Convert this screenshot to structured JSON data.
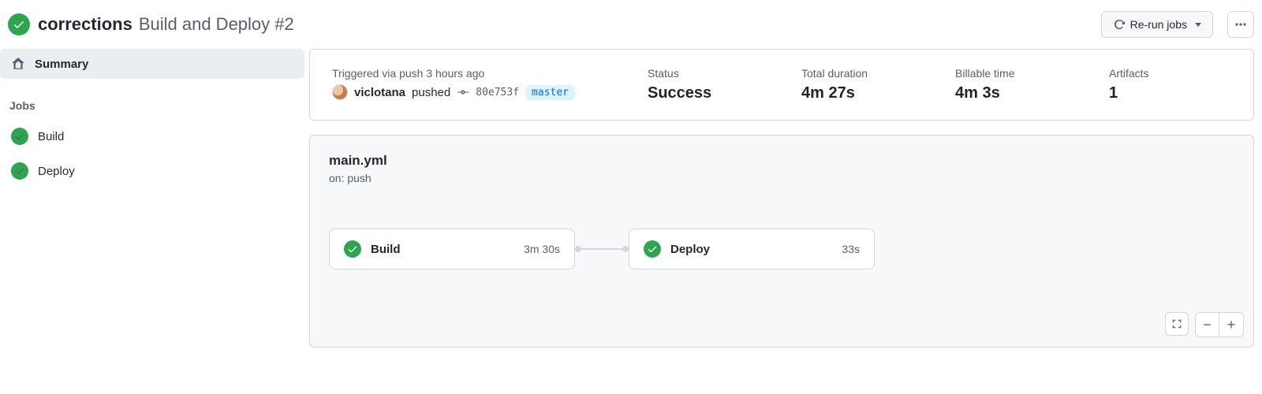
{
  "header": {
    "commit_message": "corrections",
    "workflow_title": "Build and Deploy #2",
    "rerun_button": "Re-run jobs"
  },
  "sidebar": {
    "summary_label": "Summary",
    "jobs_heading": "Jobs",
    "jobs": [
      {
        "name": "Build"
      },
      {
        "name": "Deploy"
      }
    ]
  },
  "summary": {
    "trigger_label": "Triggered via push 3 hours ago",
    "actor": "viclotana",
    "action_verb": "pushed",
    "sha": "80e753f",
    "branch": "master",
    "status_label": "Status",
    "status_value": "Success",
    "duration_label": "Total duration",
    "duration_value": "4m 27s",
    "billable_label": "Billable time",
    "billable_value": "4m 3s",
    "artifacts_label": "Artifacts",
    "artifacts_value": "1"
  },
  "graph": {
    "file": "main.yml",
    "on": "on: push",
    "nodes": [
      {
        "name": "Build",
        "duration": "3m 30s"
      },
      {
        "name": "Deploy",
        "duration": "33s"
      }
    ]
  }
}
